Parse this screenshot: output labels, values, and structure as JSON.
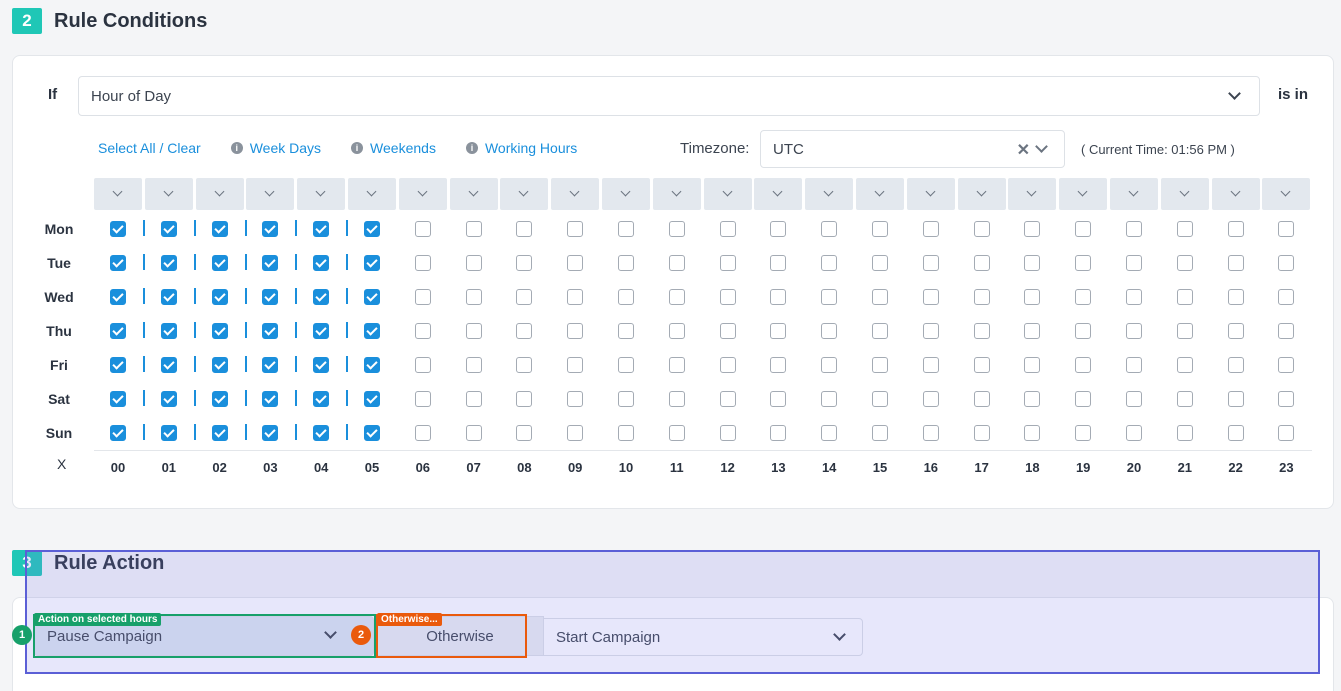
{
  "section2": {
    "number": "2",
    "title": "Rule Conditions"
  },
  "condition": {
    "if_label": "If",
    "field_value": "Hour of Day",
    "operator_label": "is in"
  },
  "quick_links": {
    "select_all": "Select All / Clear",
    "week_days": "Week Days",
    "weekends": "Weekends",
    "working_hours": "Working Hours",
    "info_glyph": "i"
  },
  "timezone": {
    "label": "Timezone:",
    "value": "UTC",
    "current_time": "( Current Time: 01:56 PM )"
  },
  "grid": {
    "days": [
      "Mon",
      "Tue",
      "Wed",
      "Thu",
      "Fri",
      "Sat",
      "Sun"
    ],
    "hours": [
      "00",
      "01",
      "02",
      "03",
      "04",
      "05",
      "06",
      "07",
      "08",
      "09",
      "10",
      "11",
      "12",
      "13",
      "14",
      "15",
      "16",
      "17",
      "18",
      "19",
      "20",
      "21",
      "22",
      "23"
    ],
    "checked_hours": [
      0,
      1,
      2,
      3,
      4,
      5
    ],
    "clear_label": "X"
  },
  "section3": {
    "number": "3",
    "title": "Rule Action"
  },
  "action": {
    "selected_action": "Pause Campaign",
    "otherwise_label": "Otherwise",
    "otherwise_action": "Start Campaign"
  },
  "annotations": [
    {
      "number": "1",
      "label": "Action on selected hours",
      "color": "#17a06a"
    },
    {
      "number": "2",
      "label": "Otherwise...",
      "color": "#ea5a0c"
    }
  ],
  "colors": {
    "accent": "#1a8fdc",
    "section_badge": "#1fc7b6",
    "overlay": "#5b5fd6"
  }
}
